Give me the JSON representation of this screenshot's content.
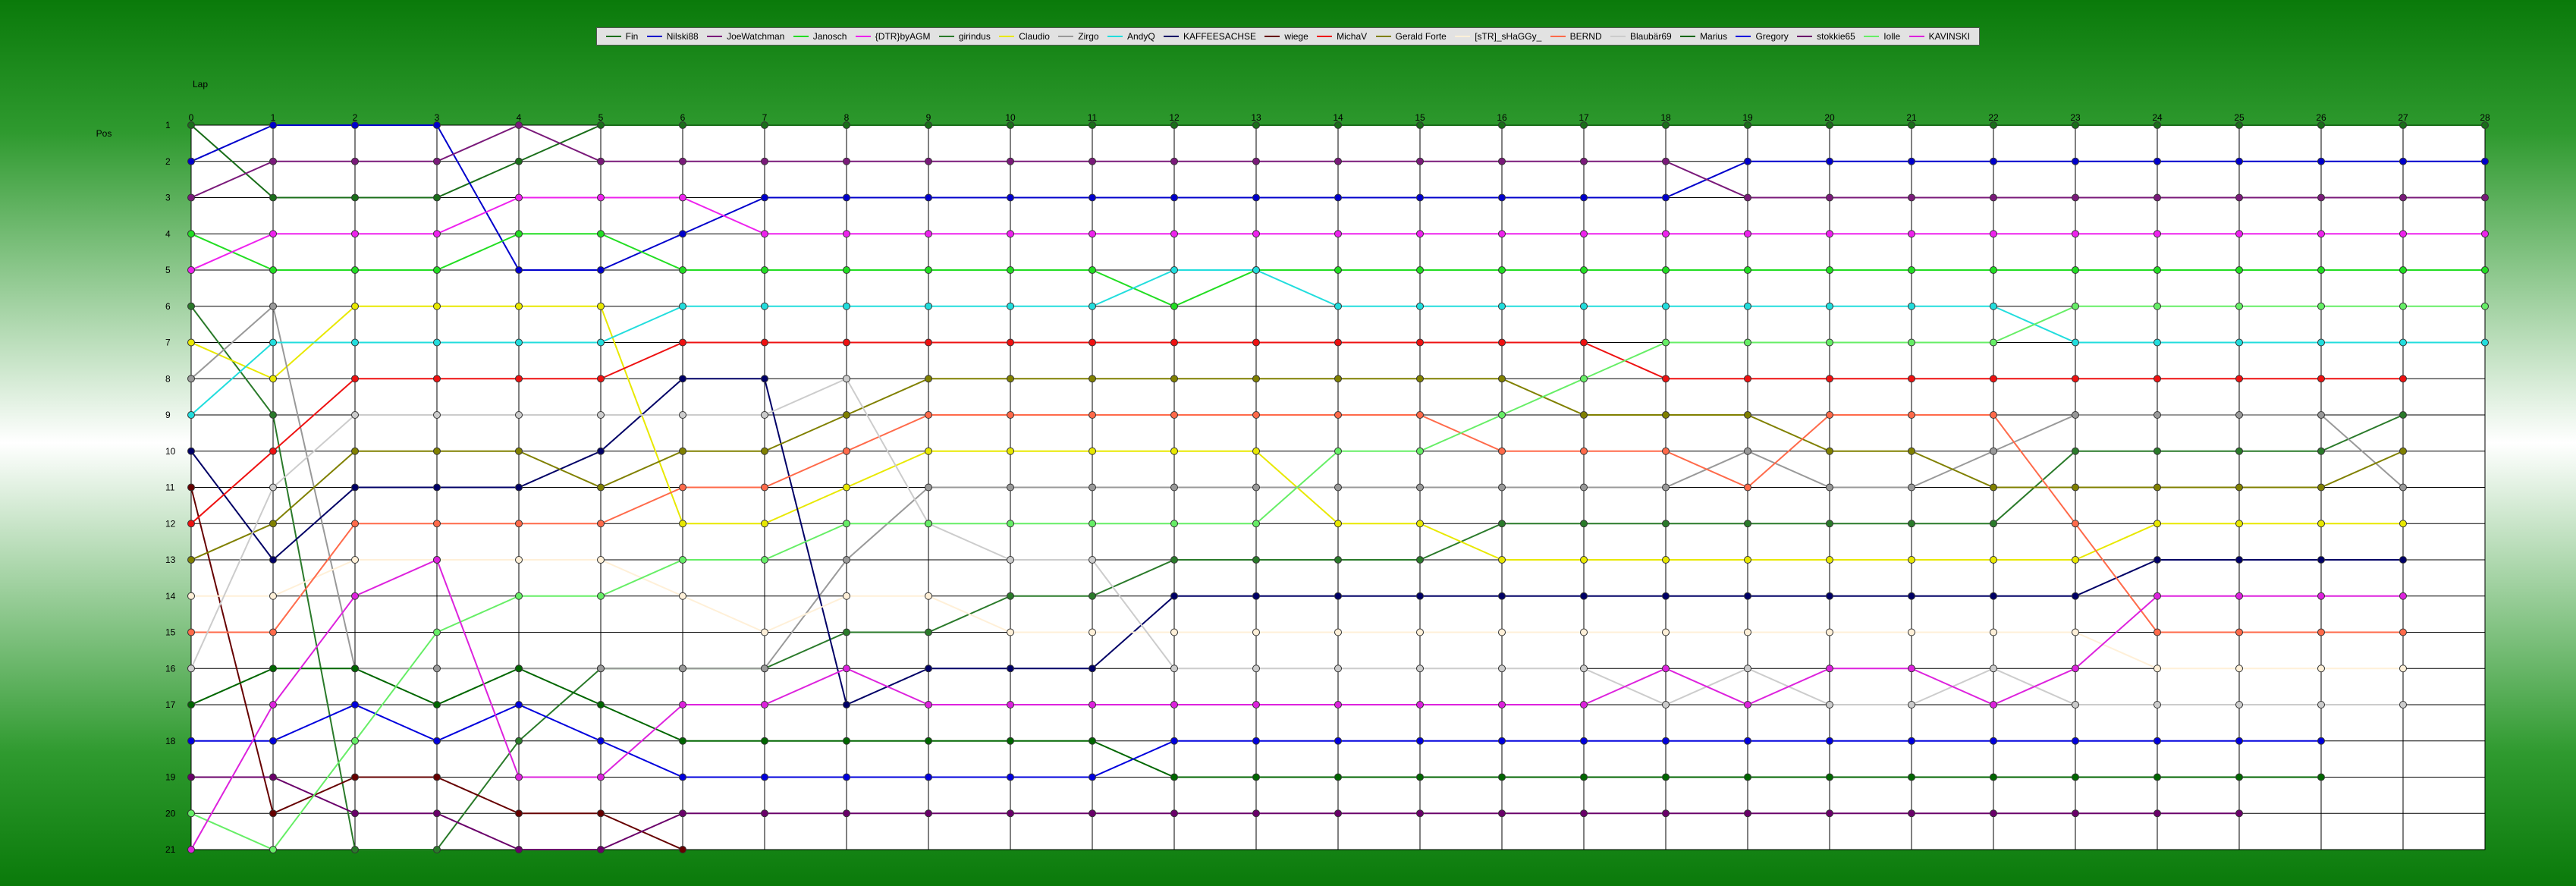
{
  "chart_data": {
    "type": "line",
    "xlabel": "Lap",
    "ylabel": "Pos",
    "xlim": [
      0,
      28
    ],
    "ylim": [
      1,
      21
    ],
    "y_inverted": true,
    "grid": true,
    "legend_placement": "top-center",
    "x": [
      0,
      1,
      2,
      3,
      4,
      5,
      6,
      7,
      8,
      9,
      10,
      11,
      12,
      13,
      14,
      15,
      16,
      17,
      18,
      19,
      20,
      21,
      22,
      23,
      24,
      25,
      26,
      27,
      28
    ],
    "y_ticks": [
      1,
      2,
      3,
      4,
      5,
      6,
      7,
      8,
      9,
      10,
      11,
      12,
      13,
      14,
      15,
      16,
      17,
      18,
      19,
      20,
      21
    ],
    "series": [
      {
        "name": "Fin",
        "color": "#1a6e1a",
        "values": [
          1,
          3,
          3,
          3,
          2,
          1,
          1,
          1,
          1,
          1,
          1,
          1,
          1,
          1,
          1,
          1,
          1,
          1,
          1,
          1,
          1,
          1,
          1,
          1,
          1,
          1,
          1,
          1,
          1
        ]
      },
      {
        "name": "Nilski88",
        "color": "#0000cc",
        "values": [
          2,
          1,
          1,
          1,
          5,
          5,
          4,
          3,
          3,
          3,
          3,
          3,
          3,
          3,
          3,
          3,
          3,
          3,
          3,
          2,
          2,
          2,
          2,
          2,
          2,
          2,
          2,
          2,
          2
        ]
      },
      {
        "name": "JoeWatchman",
        "color": "#7a1a7a",
        "values": [
          3,
          2,
          2,
          2,
          1,
          2,
          2,
          2,
          2,
          2,
          2,
          2,
          2,
          2,
          2,
          2,
          2,
          2,
          2,
          3,
          3,
          3,
          3,
          3,
          3,
          3,
          3,
          3,
          3
        ]
      },
      {
        "name": "Janosch",
        "color": "#22dd22",
        "values": [
          4,
          5,
          5,
          5,
          4,
          4,
          5,
          5,
          5,
          5,
          5,
          5,
          6,
          5,
          5,
          5,
          5,
          5,
          5,
          5,
          5,
          5,
          5,
          5,
          5,
          5,
          5,
          5,
          5
        ]
      },
      {
        "name": "{DTR}byAGM",
        "color": "#ee22ee",
        "values": [
          5,
          4,
          4,
          4,
          3,
          3,
          3,
          4,
          4,
          4,
          4,
          4,
          4,
          4,
          4,
          4,
          4,
          4,
          4,
          4,
          4,
          4,
          4,
          4,
          4,
          4,
          4,
          4,
          4
        ]
      },
      {
        "name": "girindus",
        "color": "#2a7a2a",
        "values": [
          6,
          9,
          21,
          21,
          18,
          16,
          16,
          16,
          15,
          15,
          14,
          14,
          13,
          13,
          13,
          13,
          12,
          12,
          12,
          12,
          12,
          12,
          12,
          10,
          10,
          10,
          10,
          9,
          null
        ]
      },
      {
        "name": "Claudio",
        "color": "#e8e800",
        "values": [
          7,
          8,
          6,
          6,
          6,
          6,
          12,
          12,
          11,
          10,
          10,
          10,
          10,
          10,
          12,
          12,
          13,
          13,
          13,
          13,
          13,
          13,
          13,
          13,
          12,
          12,
          12,
          12,
          null
        ]
      },
      {
        "name": "Zirgo",
        "color": "#999999",
        "values": [
          8,
          6,
          16,
          16,
          16,
          16,
          16,
          16,
          13,
          11,
          11,
          11,
          11,
          11,
          11,
          11,
          11,
          11,
          11,
          10,
          11,
          11,
          10,
          9,
          9,
          9,
          9,
          11,
          null
        ]
      },
      {
        "name": "AndyQ",
        "color": "#22dddd",
        "values": [
          9,
          7,
          7,
          7,
          7,
          7,
          6,
          6,
          6,
          6,
          6,
          6,
          5,
          5,
          6,
          6,
          6,
          6,
          6,
          6,
          6,
          6,
          6,
          7,
          7,
          7,
          7,
          7,
          7
        ]
      },
      {
        "name": "KAFFEESACHSE",
        "color": "#000066",
        "values": [
          10,
          13,
          11,
          11,
          11,
          10,
          8,
          8,
          17,
          16,
          16,
          16,
          14,
          14,
          14,
          14,
          14,
          14,
          14,
          14,
          14,
          14,
          14,
          14,
          13,
          13,
          13,
          13,
          null
        ]
      },
      {
        "name": "wiege",
        "color": "#660000",
        "values": [
          11,
          20,
          19,
          19,
          20,
          20,
          21,
          null,
          null,
          null,
          null,
          null,
          null,
          null,
          null,
          null,
          null,
          null,
          null,
          null,
          null,
          null,
          null,
          null,
          null,
          null,
          null,
          null,
          null
        ]
      },
      {
        "name": "MichaV",
        "color": "#ee1111",
        "values": [
          12,
          10,
          8,
          8,
          8,
          8,
          7,
          7,
          7,
          7,
          7,
          7,
          7,
          7,
          7,
          7,
          7,
          7,
          8,
          8,
          8,
          8,
          8,
          8,
          8,
          8,
          8,
          8,
          null
        ]
      },
      {
        "name": "Gerald Forte",
        "color": "#808000",
        "values": [
          13,
          12,
          10,
          10,
          10,
          11,
          10,
          10,
          9,
          8,
          8,
          8,
          8,
          8,
          8,
          8,
          8,
          9,
          9,
          9,
          10,
          10,
          11,
          11,
          11,
          11,
          11,
          10,
          null
        ]
      },
      {
        "name": "[sTR]_sHaGGy_",
        "color": "#fff0d8",
        "values": [
          14,
          14,
          13,
          13,
          13,
          13,
          14,
          15,
          14,
          14,
          15,
          15,
          15,
          15,
          15,
          15,
          15,
          15,
          15,
          15,
          15,
          15,
          15,
          15,
          16,
          16,
          16,
          16,
          null
        ]
      },
      {
        "name": "BERND",
        "color": "#ff6a4a",
        "values": [
          15,
          15,
          12,
          12,
          12,
          12,
          11,
          11,
          10,
          9,
          9,
          9,
          9,
          9,
          9,
          9,
          10,
          10,
          10,
          11,
          9,
          9,
          9,
          12,
          15,
          15,
          15,
          15,
          null
        ]
      },
      {
        "name": "Blaubär69",
        "color": "#cccccc",
        "values": [
          16,
          11,
          9,
          9,
          9,
          9,
          9,
          9,
          8,
          12,
          13,
          13,
          16,
          16,
          16,
          16,
          16,
          16,
          17,
          16,
          17,
          17,
          16,
          17,
          17,
          17,
          17,
          17,
          null
        ]
      },
      {
        "name": "Marius",
        "color": "#006600",
        "values": [
          17,
          16,
          16,
          17,
          16,
          17,
          18,
          18,
          18,
          18,
          18,
          18,
          19,
          19,
          19,
          19,
          19,
          19,
          19,
          19,
          19,
          19,
          19,
          19,
          19,
          19,
          19,
          null,
          null
        ]
      },
      {
        "name": "Gregory",
        "color": "#0000dd",
        "values": [
          18,
          18,
          17,
          18,
          17,
          18,
          19,
          19,
          19,
          19,
          19,
          19,
          18,
          18,
          18,
          18,
          18,
          18,
          18,
          18,
          18,
          18,
          18,
          18,
          18,
          18,
          18,
          null,
          null
        ]
      },
      {
        "name": "stokkie65",
        "color": "#6a006a",
        "values": [
          19,
          19,
          20,
          20,
          21,
          21,
          20,
          20,
          20,
          20,
          20,
          20,
          20,
          20,
          20,
          20,
          20,
          20,
          20,
          20,
          20,
          20,
          20,
          20,
          20,
          20,
          null,
          null,
          null
        ]
      },
      {
        "name": "Iolle",
        "color": "#66ee66",
        "values": [
          20,
          21,
          18,
          15,
          14,
          14,
          13,
          13,
          12,
          12,
          12,
          12,
          12,
          12,
          10,
          10,
          9,
          8,
          7,
          7,
          7,
          7,
          7,
          6,
          6,
          6,
          6,
          6,
          6
        ]
      },
      {
        "name": "KAVINSKI",
        "color": "#dd22dd",
        "values": [
          21,
          17,
          14,
          13,
          19,
          19,
          17,
          17,
          16,
          17,
          17,
          17,
          17,
          17,
          17,
          17,
          17,
          17,
          16,
          17,
          16,
          16,
          17,
          16,
          14,
          14,
          14,
          14,
          null
        ]
      }
    ]
  }
}
